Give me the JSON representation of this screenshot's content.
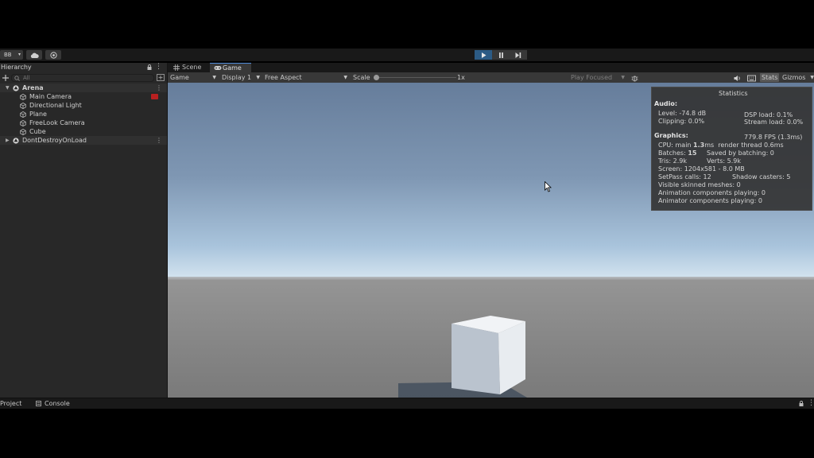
{
  "toolbar": {
    "account_label": "BB",
    "account_caret": "▾"
  },
  "hierarchy": {
    "title": "Hierarchy",
    "search_placeholder": "All",
    "menu": "⋮",
    "items": [
      {
        "label": "Arena",
        "kind": "scene",
        "expanded": true
      },
      {
        "label": "Main Camera",
        "kind": "object",
        "depth": 1
      },
      {
        "label": "Directional Light",
        "kind": "object",
        "depth": 1
      },
      {
        "label": "Plane",
        "kind": "object",
        "depth": 1
      },
      {
        "label": "FreeLook Camera",
        "kind": "object",
        "depth": 1
      },
      {
        "label": "Cube",
        "kind": "object",
        "depth": 1
      },
      {
        "label": "DontDestroyOnLoad",
        "kind": "scene",
        "expanded": false
      }
    ]
  },
  "view_tabs": [
    {
      "label": "Scene",
      "icon": "grid-icon"
    },
    {
      "label": "Game",
      "icon": "gamepad-icon",
      "active": true
    }
  ],
  "game_toolbar": {
    "mode": "Game",
    "display": "Display 1",
    "aspect": "Free Aspect",
    "scale_label": "Scale",
    "scale_value": "1x",
    "play_focused": "Play Focused",
    "stats_label": "Stats",
    "gizmos_label": "Gizmos"
  },
  "statistics": {
    "title": "Statistics",
    "audio_header": "Audio:",
    "level": "Level: -74.8 dB",
    "clipping": "Clipping: 0.0%",
    "dsp_load": "DSP load: 0.1%",
    "stream_load": "Stream load: 0.0%",
    "graphics_header": "Graphics:",
    "fps": "779.8 FPS (1.3ms)",
    "cpu_prefix": "CPU: main ",
    "cpu_main": "1.3",
    "cpu_suffix": "ms  render thread 0.6ms",
    "batches_prefix": "Batches: ",
    "batches": "15",
    "saved_batching": "Saved by batching: 0",
    "tris": "Tris: 2.9k",
    "verts": "Verts: 5.9k",
    "screen": "Screen: 1204x581 - 8.0 MB",
    "setpass": "SetPass calls: 12",
    "shadow_casters": "Shadow casters: 5",
    "skinned": "Visible skinned meshes: 0",
    "animation": "Animation components playing: 0",
    "animator": "Animator components playing: 0"
  },
  "bottom_tabs": [
    {
      "label": "Project"
    },
    {
      "label": "Console"
    }
  ],
  "colors": {
    "accent": "#2c5b85",
    "panel": "#282828",
    "toolbar": "#383838",
    "gizmo_red": "#b82020"
  }
}
